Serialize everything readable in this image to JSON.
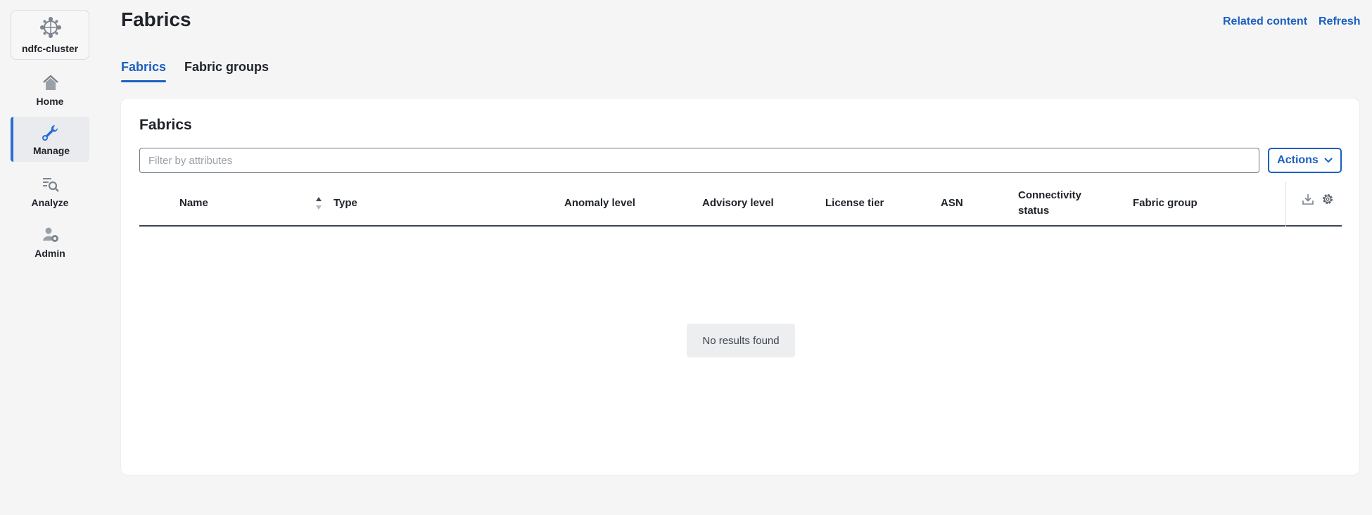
{
  "sidebar": {
    "cluster_label": "ndfc-cluster",
    "items": [
      {
        "label": "Home",
        "icon": "home-icon"
      },
      {
        "label": "Manage",
        "icon": "wrench-icon",
        "active": true
      },
      {
        "label": "Analyze",
        "icon": "analyze-icon"
      },
      {
        "label": "Admin",
        "icon": "admin-icon"
      }
    ]
  },
  "header": {
    "title": "Fabrics",
    "related_content": "Related content",
    "refresh": "Refresh"
  },
  "tabs": [
    {
      "label": "Fabrics",
      "active": true
    },
    {
      "label": "Fabric groups",
      "active": false
    }
  ],
  "card": {
    "title": "Fabrics",
    "filter_placeholder": "Filter by attributes",
    "actions_label": "Actions"
  },
  "table": {
    "columns": [
      "Name",
      "Type",
      "Anomaly level",
      "Advisory level",
      "License tier",
      "ASN",
      "Connectivity status",
      "Fabric group"
    ],
    "connectivity_line1": "Connectivity",
    "connectivity_line2": "status",
    "empty_message": "No results found"
  },
  "colors": {
    "accent": "#1b5fc1",
    "background": "#f5f5f5",
    "card": "#ffffff"
  }
}
